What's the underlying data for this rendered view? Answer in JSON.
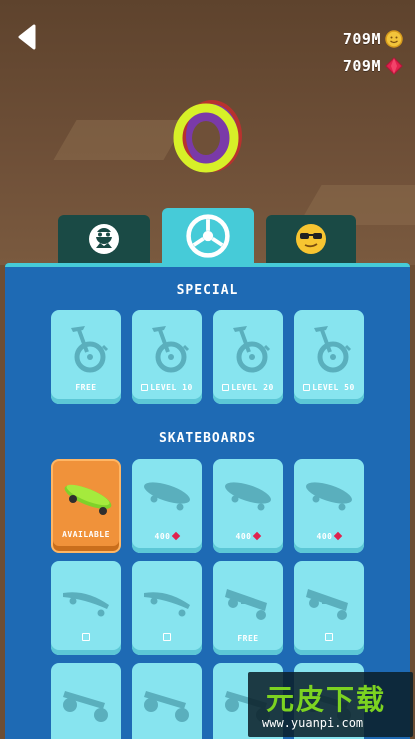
{
  "header": {
    "back_icon": "back-arrow-icon",
    "coins": {
      "value": "709M",
      "icon": "coin-icon",
      "color": "#f2c43b"
    },
    "gems": {
      "value": "709M",
      "icon": "gem-icon",
      "color": "#e0224d"
    }
  },
  "tabs": [
    {
      "name": "character",
      "icon": "character-mask-icon",
      "active": false
    },
    {
      "name": "wheels",
      "icon": "wheel-icon",
      "active": true
    },
    {
      "name": "emoji",
      "icon": "sunglasses-emoji-icon",
      "active": false
    }
  ],
  "sections": {
    "special": {
      "title": "SPECIAL",
      "items": [
        {
          "label": "FREE",
          "locked": false,
          "icon": "unicycle-icon"
        },
        {
          "label": "LEVEL 10",
          "locked": true,
          "icon": "unicycle-icon"
        },
        {
          "label": "LEVEL 20",
          "locked": true,
          "icon": "unicycle-icon"
        },
        {
          "label": "LEVEL 50",
          "locked": true,
          "icon": "unicycle-icon"
        }
      ]
    },
    "skateboards": {
      "title": "SKATEBOARDS",
      "items": [
        {
          "label": "AVAILABLE",
          "price_type": "none",
          "icon": "green-skateboard-icon",
          "selected": true
        },
        {
          "label": "400",
          "price_type": "gem",
          "icon": "skateboard-icon"
        },
        {
          "label": "400",
          "price_type": "gem",
          "icon": "skateboard-icon"
        },
        {
          "label": "400",
          "price_type": "gem",
          "icon": "skateboard-icon"
        },
        {
          "label": "",
          "price_type": "lock",
          "icon": "longboard-icon"
        },
        {
          "label": "",
          "price_type": "lock",
          "icon": "longboard-icon"
        },
        {
          "label": "FREE",
          "price_type": "none",
          "icon": "electric-board-icon"
        },
        {
          "label": "",
          "price_type": "lock",
          "icon": "electric-board-icon"
        },
        {
          "label": "",
          "price_type": "none",
          "icon": "offroad-board-icon"
        },
        {
          "label": "",
          "price_type": "none",
          "icon": "offroad-board-icon"
        },
        {
          "label": "",
          "price_type": "none",
          "icon": "offroad-board-icon"
        },
        {
          "label": "",
          "price_type": "none",
          "icon": "offroad-board-icon"
        }
      ]
    }
  },
  "watermark": {
    "title": "元皮下载",
    "url": "www.yuanpi.com"
  },
  "colors": {
    "panel": "#1e6ab4",
    "tab_active": "#46cbd8",
    "tab_inactive": "#1a4a45",
    "card": "#87e4ef",
    "card_selected": "#f0923a"
  }
}
